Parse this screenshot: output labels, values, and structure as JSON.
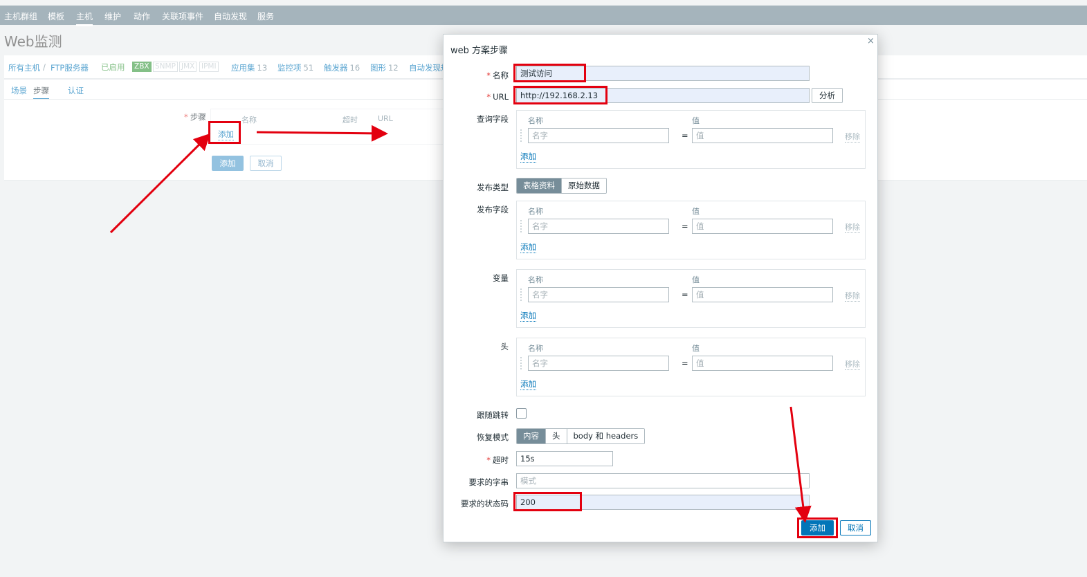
{
  "nav": {
    "items": [
      "主机群组",
      "模板",
      "主机",
      "维护",
      "动作",
      "关联项事件",
      "自动发现",
      "服务"
    ],
    "active_index": 2
  },
  "page": {
    "title": "Web监测"
  },
  "hostbar": {
    "all_hosts": "所有主机",
    "separator": "/",
    "host_name": "FTP服务器",
    "enabled": "已启用",
    "badges": [
      "ZBX",
      "SNMP",
      "JMX",
      "IPMI"
    ],
    "links": [
      {
        "label": "应用集",
        "count": "13"
      },
      {
        "label": "监控项",
        "count": "51"
      },
      {
        "label": "触发器",
        "count": "16"
      },
      {
        "label": "图形",
        "count": "12"
      },
      {
        "label": "自动发现规",
        "count": ""
      }
    ]
  },
  "tabs": {
    "scenario": "场景",
    "steps": "步骤",
    "auth": "认证"
  },
  "steps_form": {
    "label": "步骤",
    "col_name": "名称",
    "col_timeout": "超时",
    "col_url": "URL",
    "add_link": "添加",
    "add_button": "添加",
    "cancel_button": "取消"
  },
  "dialog": {
    "title": "web 方案步骤",
    "close": "×",
    "name_label": "名称",
    "name_value": "测试访问",
    "url_label": "URL",
    "url_value": "http://192.168.2.13",
    "parse_button": "分析",
    "col_name": "名称",
    "col_value": "值",
    "placeholder_name": "名字",
    "placeholder_value": "值",
    "equals": "=",
    "remove": "移除",
    "add": "添加",
    "query_label": "查询字段",
    "post_type_label": "发布类型",
    "post_type_options": [
      "表格资料",
      "原始数据"
    ],
    "post_fields_label": "发布字段",
    "variables_label": "变量",
    "headers_label": "头",
    "follow_redirects_label": "跟随跳转",
    "retrieve_mode_label": "恢复模式",
    "retrieve_mode_options": [
      "内容",
      "头",
      "body 和 headers"
    ],
    "timeout_label": "超时",
    "timeout_value": "15s",
    "required_string_label": "要求的字串",
    "required_string_placeholder": "模式",
    "status_codes_label": "要求的状态码",
    "status_codes_value": "200",
    "add_button": "添加",
    "cancel_button": "取消"
  },
  "colors": {
    "nav_bg": "#768d99",
    "link": "#0275b8",
    "enabled": "#429e47",
    "highlight": "#e3000f"
  }
}
